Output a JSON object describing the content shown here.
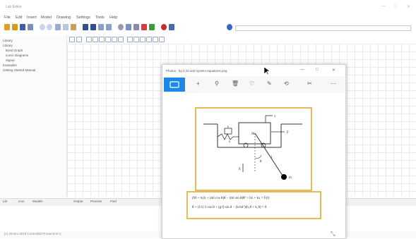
{
  "app": {
    "title": "Lab Editor",
    "window_controls": [
      "—",
      "□",
      "✕"
    ]
  },
  "menu": [
    "File",
    "Edit",
    "Insert",
    "Model",
    "Drawing",
    "Settings",
    "Tools",
    "Help"
  ],
  "toolbar": {
    "icons": [
      "new-icon",
      "open-icon",
      "save-icon",
      "print-icon",
      "undo-icon",
      "redo-icon",
      "cut-icon",
      "copy-icon",
      "paste-icon",
      "arrow-left-icon",
      "arrow-up-icon",
      "arrow-down-icon",
      "arrow-right-icon",
      "zoom-icon",
      "settings-icon",
      "pen-icon",
      "lock-icon",
      "pencil-icon",
      "record-icon",
      "run-icon",
      "stop-icon"
    ],
    "search_value": ""
  },
  "sidebar": {
    "items": [
      {
        "label": "Library"
      },
      {
        "label": "Library"
      },
      {
        "label": "Bond Graph"
      },
      {
        "label": "Iconic Diagrams"
      },
      {
        "label": "Signal"
      },
      {
        "label": "Examples"
      },
      {
        "label": "Getting Started Manual"
      }
    ]
  },
  "bottom_tabs": [
    "Lib",
    "Icon",
    "Models",
    "Output",
    "Process",
    "Find"
  ],
  "status": {
    "text": "(c) 20-sim 2019 Controllab Products B.V."
  },
  "photos": {
    "title": "Photos - fig 2.10 and system equations.png",
    "window_controls": [
      "—",
      "□",
      "✕"
    ],
    "tools": [
      "+",
      "⚲",
      "🗑",
      "♡",
      "✎",
      "⟲",
      "✂",
      "⋯"
    ],
    "diagram_labels": {
      "x": "x",
      "f": "F",
      "m": "M",
      "k": "k",
      "b": "b",
      "theta": "θ",
      "l": "l",
      "mass_small": "m",
      "g": "g"
    },
    "equations": [
      "(M + m)ẍ + (ml cos θ)θ̈ − (ml sin θ)θ̇² + bẋ + kx = F(t)",
      "θ̈ + (1/l) ẍ cos θ + (g/l) sin θ − (k/ml²)(b₁θ̇ + k₁θ) = 0"
    ]
  },
  "colors": {
    "accent_blue": "#1e88e5",
    "frame_gold": "#e6b959",
    "grid": "#e9e9f2"
  }
}
